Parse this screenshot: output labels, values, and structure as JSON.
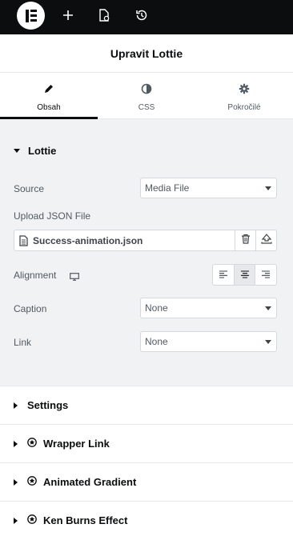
{
  "topbar": {
    "logo": "elementor-logo",
    "icons": [
      "plus-icon",
      "page-settings-icon",
      "history-icon"
    ]
  },
  "header": {
    "title": "Upravit Lottie"
  },
  "tabs": [
    {
      "label": "Obsah",
      "icon": "pencil-icon",
      "active": true
    },
    {
      "label": "CSS",
      "icon": "half-circle-icon",
      "active": false
    },
    {
      "label": "Pokročilé",
      "icon": "gear-icon",
      "active": false
    }
  ],
  "lottie_section": {
    "title": "Lottie",
    "source": {
      "label": "Source",
      "value": "Media File"
    },
    "upload": {
      "label": "Upload JSON File",
      "file_name": "Success-animation.json"
    },
    "alignment": {
      "label": "Alignment",
      "selected": "center"
    },
    "caption": {
      "label": "Caption",
      "value": "None"
    },
    "link": {
      "label": "Link",
      "value": "None"
    }
  },
  "collapsed_sections": [
    {
      "title": "Settings",
      "pro": false
    },
    {
      "title": "Wrapper Link",
      "pro": true
    },
    {
      "title": "Animated Gradient",
      "pro": true
    },
    {
      "title": "Ken Burns Effect",
      "pro": true
    }
  ],
  "colors": {
    "topbar": "#0c0d0e",
    "panel_bg": "#f1f2f3",
    "border": "#d5d8dc",
    "text": "#515962"
  }
}
